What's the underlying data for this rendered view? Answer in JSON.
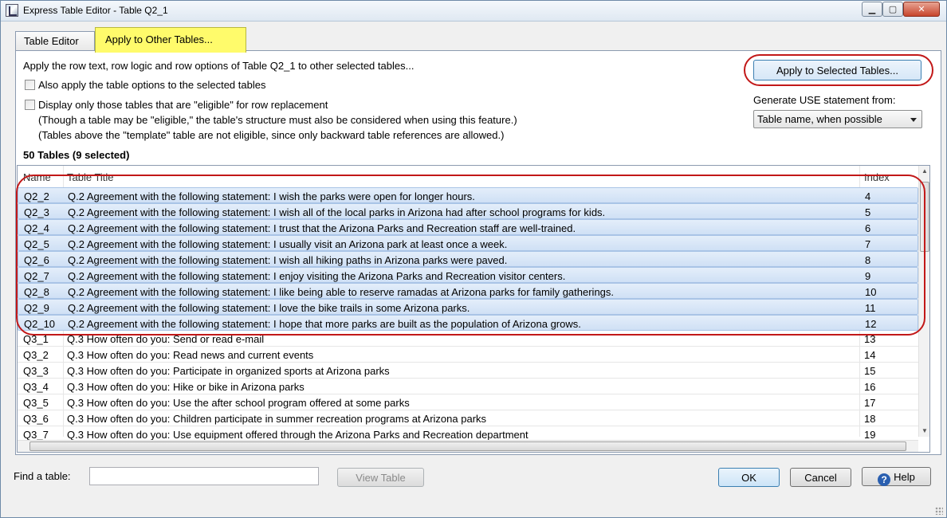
{
  "window": {
    "title": "Express Table Editor - Table Q2_1"
  },
  "tabs": [
    {
      "label": "Table Editor"
    },
    {
      "label": "Apply to Other Tables..."
    }
  ],
  "panel": {
    "intro": "Apply the row text, row logic and row options of Table Q2_1 to other selected tables...",
    "apply_button": "Apply to Selected Tables...",
    "also_apply_label": "Also apply the table options to the selected tables",
    "eligible_label": "Display only those tables that are \"eligible\" for row replacement",
    "eligible_note1": "(Though a table may be \"eligible,\" the table's structure must also be considered when using this feature.)",
    "eligible_note2": "(Tables above the \"template\" table are not eligible, since only backward table references are allowed.)",
    "generate_label": "Generate USE statement from:",
    "generate_value": "Table name, when possible",
    "count_label": "50 Tables  (9 selected)"
  },
  "table": {
    "columns": {
      "name": "Name",
      "title": "Table Title",
      "index": "Index"
    },
    "rows": [
      {
        "name": "Q2_2",
        "title": "Q.2 Agreement with the following statement: I wish the parks were open for longer hours.",
        "index": "4",
        "selected": true
      },
      {
        "name": "Q2_3",
        "title": "Q.2 Agreement with the following statement: I wish all of the local parks in Arizona had after school programs for kids.",
        "index": "5",
        "selected": true
      },
      {
        "name": "Q2_4",
        "title": "Q.2 Agreement with the following statement: I trust that the Arizona Parks and Recreation staff are well-trained.",
        "index": "6",
        "selected": true
      },
      {
        "name": "Q2_5",
        "title": "Q.2 Agreement with the following statement: I usually visit an Arizona park at least once a week.",
        "index": "7",
        "selected": true
      },
      {
        "name": "Q2_6",
        "title": "Q.2 Agreement with the following statement: I wish all hiking paths in Arizona parks were paved.",
        "index": "8",
        "selected": true
      },
      {
        "name": "Q2_7",
        "title": "Q.2 Agreement with the following statement: I enjoy visiting the Arizona Parks and Recreation visitor centers.",
        "index": "9",
        "selected": true
      },
      {
        "name": "Q2_8",
        "title": "Q.2 Agreement with the following statement: I like being able to reserve ramadas at Arizona parks for family gatherings.",
        "index": "10",
        "selected": true
      },
      {
        "name": "Q2_9",
        "title": "Q.2 Agreement with the following statement: I love the bike trails in some Arizona parks.",
        "index": "11",
        "selected": true
      },
      {
        "name": "Q2_10",
        "title": "Q.2 Agreement with the following statement: I hope that more parks are built as the population of Arizona grows.",
        "index": "12",
        "selected": true
      },
      {
        "name": "Q3_1",
        "title": "Q.3 How often do you: Send or read e-mail",
        "index": "13",
        "selected": false
      },
      {
        "name": "Q3_2",
        "title": "Q.3 How often do you: Read news and current events",
        "index": "14",
        "selected": false
      },
      {
        "name": "Q3_3",
        "title": "Q.3 How often do you: Participate in organized sports at Arizona parks",
        "index": "15",
        "selected": false
      },
      {
        "name": "Q3_4",
        "title": "Q.3 How often do you: Hike or bike in Arizona parks",
        "index": "16",
        "selected": false
      },
      {
        "name": "Q3_5",
        "title": "Q.3 How often do you: Use the after school program offered at some parks",
        "index": "17",
        "selected": false
      },
      {
        "name": "Q3_6",
        "title": "Q.3 How often do you: Children participate in summer recreation programs at Arizona parks",
        "index": "18",
        "selected": false
      },
      {
        "name": "Q3_7",
        "title": "Q.3 How often do you: Use equipment offered through the Arizona Parks and Recreation department",
        "index": "19",
        "selected": false
      }
    ]
  },
  "footer": {
    "find_label": "Find a table:",
    "find_value": "",
    "view_button": "View Table",
    "ok_button": "OK",
    "cancel_button": "Cancel",
    "help_button": "Help"
  },
  "colors": {
    "highlight_tab": "#fffb6b",
    "annotation_ring": "#c21818",
    "selected_row": "#d6e4f6"
  },
  "icons": [
    "app-icon",
    "minimize-icon",
    "maximize-icon",
    "close-icon",
    "dropdown-arrow-icon",
    "help-icon"
  ]
}
